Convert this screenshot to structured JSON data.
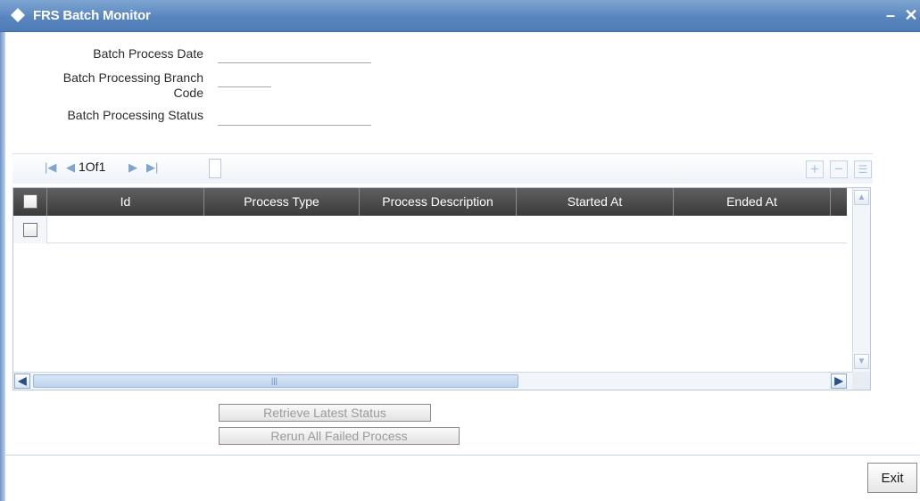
{
  "window": {
    "title": "FRS Batch Monitor",
    "minimize_glyph": "–",
    "close_glyph": "✕"
  },
  "form": {
    "batch_process_date_label": "Batch Process Date",
    "batch_processing_branch_code_label_line1": "Batch Processing Branch",
    "batch_processing_branch_code_label_line2": "Code",
    "batch_processing_status_label": "Batch Processing Status",
    "batch_process_date_value": "",
    "batch_processing_branch_code_value": "",
    "batch_processing_status_value": ""
  },
  "grid": {
    "page_indicator": "1Of1",
    "columns": [
      "Id",
      "Process Type",
      "Process Description",
      "Started At",
      "Ended At"
    ],
    "rows": [],
    "scroll_grip": "|||",
    "icons": {
      "first": "first-page-icon",
      "prev": "prev-page-icon",
      "next": "next-page-icon",
      "last": "last-page-icon",
      "add": "add-row-icon",
      "delete": "delete-row-icon",
      "view": "single-view-icon"
    }
  },
  "actions": {
    "retrieve_latest_status": "Retrieve Latest Status",
    "rerun_all_failed_process": "Rerun All Failed Process"
  },
  "footer": {
    "exit_label": "Exit"
  },
  "colors": {
    "titlebar": "#5a86bf",
    "grid_header": "#4a4a4a",
    "accent_icon": "#7ea4cf"
  }
}
